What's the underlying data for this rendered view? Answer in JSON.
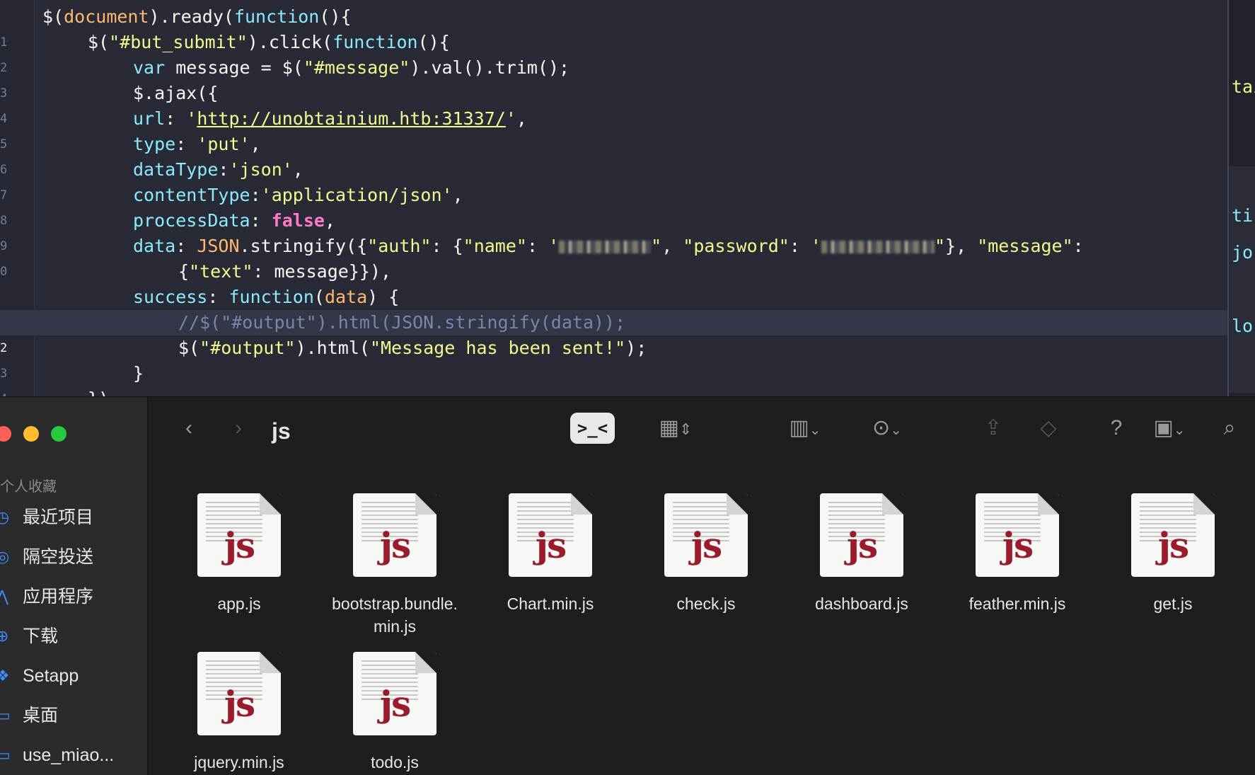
{
  "editor": {
    "lines": [
      {
        "n": "1"
      },
      {
        "n": "2"
      },
      {
        "n": "3"
      },
      {
        "n": "4"
      },
      {
        "n": "5"
      },
      {
        "n": "6"
      },
      {
        "n": "7"
      },
      {
        "n": "8"
      },
      {
        "n": "9"
      },
      {
        "n": "0"
      },
      {
        "n": ""
      },
      {
        "n": "1"
      },
      {
        "n": "2"
      },
      {
        "n": "3"
      },
      {
        "n": "4"
      }
    ],
    "tokens": {
      "l1a": "$(",
      "l1b": "document",
      "l1c": ").ready(",
      "l1d": "function",
      "l1e": "(){",
      "l2a": "$(",
      "l2b": "\"#but_submit\"",
      "l2c": ").click(",
      "l2d": "function",
      "l2e": "(){",
      "l3a": "var",
      "l3b": " message = $(",
      "l3c": "\"#message\"",
      "l3d": ").val().trim();",
      "l4a": "$.ajax({",
      "l5a": "url",
      "l5b": ": ",
      "l5c": "'",
      "l5d": "http://unobtainium.htb:31337/",
      "l5e": "'",
      "l5f": ",",
      "l6a": "type",
      "l6b": ": ",
      "l6c": "'put'",
      "l6d": ",",
      "l7a": "dataType",
      "l7b": ":",
      "l7c": "'json'",
      "l7d": ",",
      "l8a": "contentType",
      "l8b": ":",
      "l8c": "'application/json'",
      "l8d": ",",
      "l9a": "processData",
      "l9b": ": ",
      "l9c": "false",
      "l9d": ",",
      "l10a": "data",
      "l10b": ": ",
      "l10c": "JSON",
      "l10d": ".stringify({",
      "l10e": "\"auth\"",
      "l10f": ": {",
      "l10g": "\"name\"",
      "l10h": ": ",
      "l10i": "'",
      "l10j": "\"",
      "l10k": ", ",
      "l10l": "\"password\"",
      "l10m": ": ",
      "l10n": "'",
      "l10o": "\"",
      "l10p": "}, ",
      "l10q": "\"message\"",
      "l10r": ":",
      "l11a": "{",
      "l11b": "\"text\"",
      "l11c": ": message}}),",
      "l12a": "success",
      "l12b": ": ",
      "l12c": "function",
      "l12d": "(",
      "l12e": "data",
      "l12f": ") {",
      "l13a": "//$(\"#output\").html(JSON.stringify(data));",
      "l14a": "$(",
      "l14b": "\"#output\"",
      "l14c": ").html(",
      "l14d": "\"Message has been sent!\"",
      "l14e": ");",
      "l15a": "}",
      "l16a": "})"
    },
    "minimap": [
      "tai",
      "ti",
      "jo",
      "lo"
    ]
  },
  "finder": {
    "sidebar_section": "个人收藏",
    "sidebar_items": [
      {
        "label": "最近项目",
        "icon": "clock-icon"
      },
      {
        "label": "隔空投送",
        "icon": "airdrop-icon"
      },
      {
        "label": "应用程序",
        "icon": "apps-icon"
      },
      {
        "label": "下载",
        "icon": "download-icon"
      },
      {
        "label": "Setapp",
        "icon": "setapp-icon"
      },
      {
        "label": "桌面",
        "icon": "desktop-icon"
      },
      {
        "label": "use_miao...",
        "icon": "folder-icon"
      }
    ],
    "folder_title": "js",
    "terminal_label": ">_<",
    "files": [
      {
        "name": "app.js",
        "line2": ""
      },
      {
        "name": "bootstrap.bundle.",
        "line2": "min.js"
      },
      {
        "name": "Chart.min.js",
        "line2": ""
      },
      {
        "name": "check.js",
        "line2": ""
      },
      {
        "name": "dashboard.js",
        "line2": ""
      },
      {
        "name": "feather.min.js",
        "line2": ""
      },
      {
        "name": "get.js",
        "line2": ""
      },
      {
        "name": "jquery.min.js",
        "line2": ""
      },
      {
        "name": "todo.js",
        "line2": ""
      }
    ],
    "file_badge": "js"
  }
}
